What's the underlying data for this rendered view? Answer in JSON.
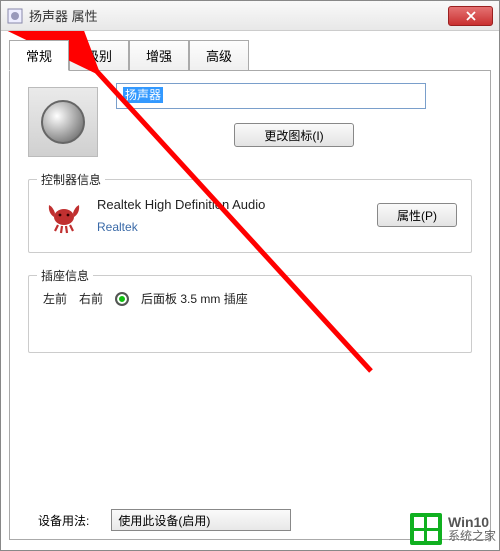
{
  "window": {
    "title": "扬声器 属性"
  },
  "tabs": {
    "items": [
      {
        "label": "常规"
      },
      {
        "label": "级别"
      },
      {
        "label": "增强"
      },
      {
        "label": "高级"
      }
    ]
  },
  "general": {
    "device_name": "扬声器",
    "change_icon_btn": "更改图标(I)"
  },
  "controller": {
    "legend": "控制器信息",
    "name": "Realtek High Definition Audio",
    "vendor": "Realtek",
    "properties_btn": "属性(P)"
  },
  "jack": {
    "legend": "插座信息",
    "lf": "左前",
    "rf": "右前",
    "desc": "后面板 3.5 mm 插座"
  },
  "usage": {
    "label": "设备用法:",
    "value": "使用此设备(启用)"
  },
  "watermark": {
    "line1": "Win10",
    "line2": "系统之家"
  }
}
